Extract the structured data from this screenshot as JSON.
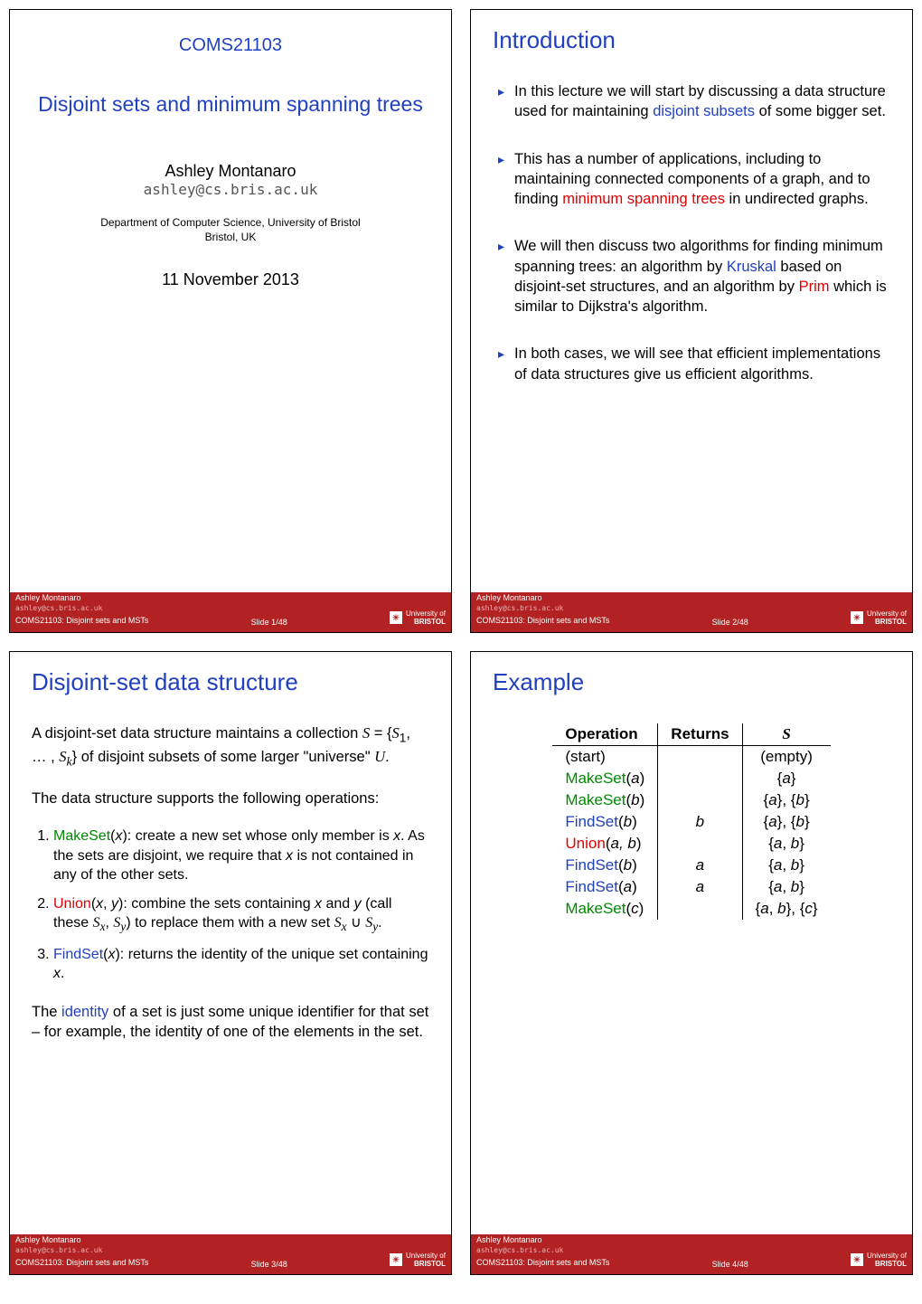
{
  "footer": {
    "author": "Ashley Montanaro",
    "email": "ashley@cs.bris.ac.uk",
    "course": "COMS21103: Disjoint sets and MSTs",
    "uni_line1": "University of",
    "uni_line2": "BRISTOL"
  },
  "slides": [
    {
      "num": "Slide 1/48",
      "title_top": "COMS21103",
      "title_main": "Disjoint sets and minimum spanning trees",
      "author": "Ashley Montanaro",
      "email": "ashley@cs.bris.ac.uk",
      "dept1": "Department of Computer Science, University of Bristol",
      "dept2": "Bristol, UK",
      "date": "11 November 2013"
    },
    {
      "num": "Slide 2/48",
      "title": "Introduction",
      "bullets": [
        {
          "pre": "In this lecture we will start by discussing a data structure used for maintaining ",
          "hl": "disjoint subsets",
          "hl_class": "blue",
          "post": " of some bigger set."
        },
        {
          "pre": "This has a number of applications, including to maintaining connected components of a graph, and to finding ",
          "hl": "minimum spanning trees",
          "hl_class": "red",
          "post": " in undirected graphs."
        },
        {
          "pre": "We will then discuss two algorithms for finding minimum spanning trees: an algorithm by ",
          "hl": "Kruskal",
          "hl_class": "blue",
          "mid": " based on disjoint-set structures, and an algorithm by ",
          "hl2": "Prim",
          "hl2_class": "red",
          "post": " which is similar to Dijkstra's algorithm."
        },
        {
          "pre": "In both cases, we will see that efficient implementations of data structures give us efficient algorithms.",
          "hl": "",
          "post": ""
        }
      ]
    },
    {
      "num": "Slide 3/48",
      "title": "Disjoint-set data structure",
      "intro_a": "A disjoint-set data structure maintains a collection ",
      "intro_math": "S = {S₁, … , Sₖ}",
      "intro_b": " of disjoint subsets of some larger \"universe\" ",
      "intro_u": "U",
      "intro_c": ".",
      "ops_lead": "The data structure supports the following operations:",
      "ops": [
        {
          "name": "MakeSet",
          "arg": "x",
          "class": "green",
          "desc_a": ": create a new set whose only member is ",
          "desc_b": ". As the sets are disjoint, we require that ",
          "desc_c": " is not contained in any of the other sets."
        },
        {
          "name": "Union",
          "arg": "x, y",
          "class": "red",
          "desc_a": ": combine the sets containing ",
          "xy": "x",
          "and": " and ",
          "y": "y",
          "desc_b": " (call these ",
          "sx": "Sₓ",
          "comma": ", ",
          "sy": "Sᵧ",
          "desc_c": ") to replace them with a new set ",
          "union": "Sₓ ∪ Sᵧ",
          "dot": "."
        },
        {
          "name": "FindSet",
          "arg": "x",
          "class": "blue",
          "desc_a": ": returns the identity of the unique set containing ",
          "dot": "."
        }
      ],
      "ident_a": "The ",
      "ident_hl": "identity",
      "ident_b": " of a set is just some unique identifier for that set – for example, the identity of one of the elements in the set."
    },
    {
      "num": "Slide 4/48",
      "title": "Example",
      "table": {
        "headers": [
          "Operation",
          "Returns",
          "S"
        ],
        "rows": [
          {
            "op_plain": "(start)",
            "ret": "",
            "s": "(empty)"
          },
          {
            "op": "MakeSet",
            "op_class": "op-make",
            "arg": "a",
            "ret": "",
            "s": "{a}"
          },
          {
            "op": "MakeSet",
            "op_class": "op-make",
            "arg": "b",
            "ret": "",
            "s": "{a}, {b}"
          },
          {
            "op": "FindSet",
            "op_class": "op-find",
            "arg": "b",
            "ret": "b",
            "s": "{a}, {b}"
          },
          {
            "op": "Union",
            "op_class": "op-union",
            "arg": "a, b",
            "ret": "",
            "s": "{a, b}"
          },
          {
            "op": "FindSet",
            "op_class": "op-find",
            "arg": "b",
            "ret": "a",
            "s": "{a, b}"
          },
          {
            "op": "FindSet",
            "op_class": "op-find",
            "arg": "a",
            "ret": "a",
            "s": "{a, b}"
          },
          {
            "op": "MakeSet",
            "op_class": "op-make",
            "arg": "c",
            "ret": "",
            "s": "{a, b}, {c}"
          }
        ]
      }
    }
  ]
}
